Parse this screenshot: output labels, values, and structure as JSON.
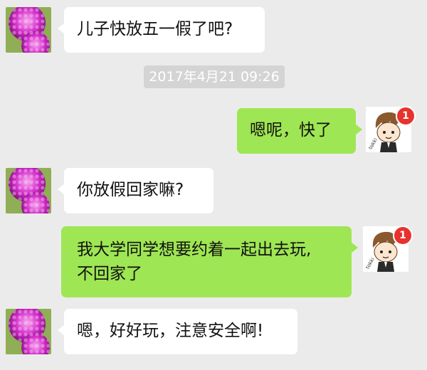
{
  "conversation": {
    "messages": [
      {
        "sender": "mom",
        "text": "儿子快放五一假了吧?"
      },
      {
        "sender": "son",
        "text": "嗯呢，快了"
      },
      {
        "sender": "mom",
        "text": "你放假回家嘛?"
      },
      {
        "sender": "son",
        "line1": "我大学同学想要约着一起出去玩,",
        "line2": "不回家了"
      },
      {
        "sender": "mom",
        "text": "嗯，好好玩，注意安全啊!"
      }
    ],
    "timestamp": "2017年4月21 09:26",
    "badge_count": "1",
    "son_avatar_doodle_text": "tokki"
  },
  "colors": {
    "background": "#ebebeb",
    "incoming_bubble": "#ffffff",
    "outgoing_bubble": "#9ee653",
    "badge": "#e8322d"
  },
  "icons": {
    "mom_avatar": "dahlia-flower-avatar-icon",
    "son_avatar": "cartoon-boy-avatar-icon",
    "badge": "notification-badge-icon"
  }
}
